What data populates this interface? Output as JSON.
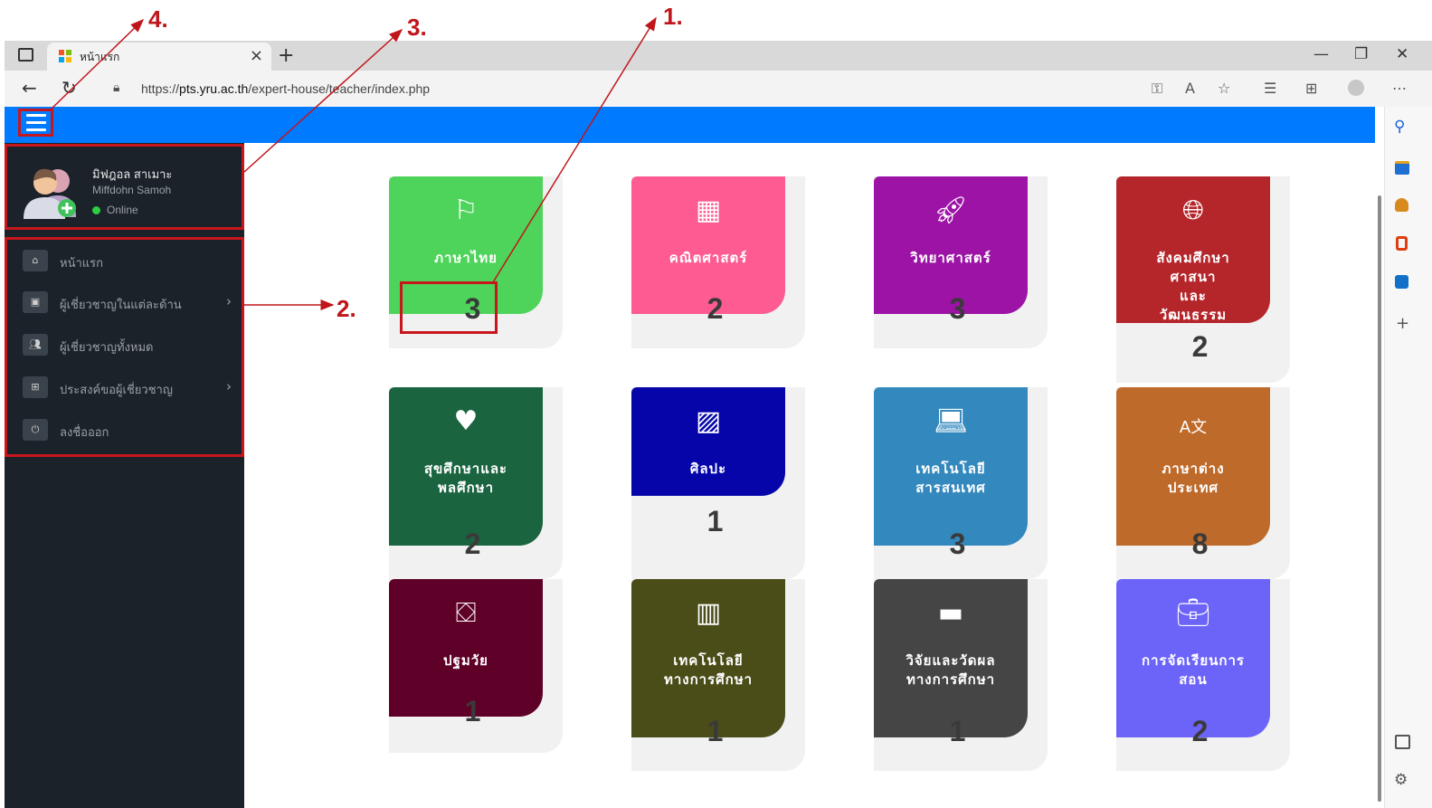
{
  "annotations": {
    "a1": "1.",
    "a2": "2.",
    "a3": "3.",
    "a4": "4."
  },
  "browser": {
    "tab_title": "หน้าแรก",
    "tab_close": "×",
    "new_tab": "+",
    "url_scheme": "https://",
    "url_host": "pts.yru.ac.th",
    "url_path": "/expert-house/teacher/index.php"
  },
  "user": {
    "name_th": "มิฟฎอล สาเมาะ",
    "name_en": "Miffdohn Samoh",
    "status": "Online"
  },
  "menu": [
    {
      "label": "หน้าแรก",
      "icon": "home-icon",
      "has_sub": false
    },
    {
      "label": "ผู้เชี่ยวชาญในแต่ละด้าน",
      "icon": "id-card-icon",
      "has_sub": true
    },
    {
      "label": "ผู้เชี่ยวชาญทั้งหมด",
      "icon": "users-icon",
      "has_sub": false
    },
    {
      "label": "ประสงค์ขอผู้เชี่ยวชาญ",
      "icon": "plus-square-icon",
      "has_sub": true
    },
    {
      "label": "ลงชื่อออก",
      "icon": "power-icon",
      "has_sub": false
    }
  ],
  "cards": [
    {
      "label": "ภาษาไทย",
      "count": "3",
      "icon": "flag-icon",
      "color": "#4ed45a"
    },
    {
      "label": "คณิตศาสตร์",
      "count": "2",
      "icon": "calculator-icon",
      "color": "#fd5b91"
    },
    {
      "label": "วิทยาศาสตร์",
      "count": "3",
      "icon": "rocket-icon",
      "color": "#9c13a6"
    },
    {
      "label": "สังคมศึกษา ศาสนา และ วัฒนธรรม",
      "count": "2",
      "icon": "globe-icon",
      "color": "#b5262b"
    },
    {
      "label": "สุขศึกษาและ พลศึกษา",
      "count": "2",
      "icon": "heartbeat-icon",
      "color": "#1a6440"
    },
    {
      "label": "ศิลปะ",
      "count": "1",
      "icon": "image-file-icon",
      "color": "#0505aa"
    },
    {
      "label": "เทคโนโลยี สารสนเทศ",
      "count": "3",
      "icon": "laptop-icon",
      "color": "#3388be"
    },
    {
      "label": "ภาษาต่าง ประเทศ",
      "count": "8",
      "icon": "translate-icon",
      "color": "#bd6a2a"
    },
    {
      "label": "ปฐมวัย",
      "count": "1",
      "icon": "cubes-icon",
      "color": "#5f0028"
    },
    {
      "label": "เทคโนโลยี ทางการศึกษา",
      "count": "1",
      "icon": "building-icon",
      "color": "#4b4d19"
    },
    {
      "label": "วิจัยและวัดผล ทางการศึกษา",
      "count": "1",
      "icon": "book-icon",
      "color": "#454545"
    },
    {
      "label": "การจัดเรียนการ สอน",
      "count": "2",
      "icon": "briefcase-icon",
      "color": "#6c63f8"
    }
  ]
}
